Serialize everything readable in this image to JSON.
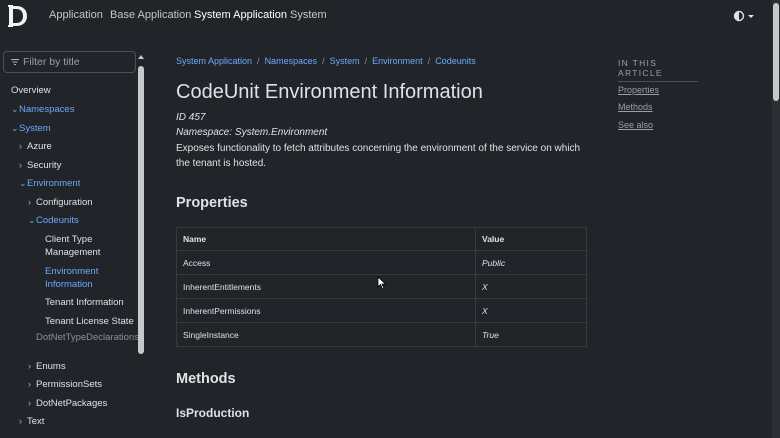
{
  "nav": {
    "items": [
      "Application",
      "Base Application",
      "System Application",
      "System"
    ],
    "active_index": 2,
    "theme_icon": "half-circle-icon"
  },
  "sidebar": {
    "filter_placeholder": "Filter by title",
    "items": [
      {
        "label": "Overview",
        "level": 0,
        "state": "none",
        "style": "normal"
      },
      {
        "label": "Namespaces",
        "level": 0,
        "state": "open",
        "style": "link"
      },
      {
        "label": "System",
        "level": 1,
        "state": "open",
        "style": "link"
      },
      {
        "label": "Azure",
        "level": 2,
        "state": "closed",
        "style": "normal"
      },
      {
        "label": "Security",
        "level": 2,
        "state": "closed",
        "style": "normal"
      },
      {
        "label": "Environment",
        "level": 2,
        "state": "open",
        "style": "link"
      },
      {
        "label": "Configuration",
        "level": 3,
        "state": "closed",
        "style": "normal"
      },
      {
        "label": "Codeunits",
        "level": 3,
        "state": "open",
        "style": "link"
      },
      {
        "label": "Client Type Management",
        "level": 4,
        "state": "none",
        "style": "normal"
      },
      {
        "label": "Environment Information",
        "level": 4,
        "state": "none",
        "style": "link"
      },
      {
        "label": "Tenant Information",
        "level": 4,
        "state": "none",
        "style": "normal"
      },
      {
        "label": "Tenant License State",
        "level": 4,
        "state": "none",
        "style": "normal"
      },
      {
        "label": "DotNetTypeDeclarations",
        "level": 3,
        "state": "none",
        "style": "muted"
      },
      {
        "label": "Enums",
        "level": 3,
        "state": "closed",
        "style": "normal"
      },
      {
        "label": "PermissionSets",
        "level": 3,
        "state": "closed",
        "style": "normal"
      },
      {
        "label": "DotNetPackages",
        "level": 3,
        "state": "closed",
        "style": "normal"
      },
      {
        "label": "Text",
        "level": 2,
        "state": "closed",
        "style": "normal"
      }
    ]
  },
  "breadcrumb": [
    "System Application",
    "Namespaces",
    "System",
    "Environment",
    "Codeunits"
  ],
  "page": {
    "title": "CodeUnit Environment Information",
    "id": "ID 457",
    "namespace": "Namespace: System.Environment",
    "description": "Exposes functionality to fetch attributes concerning the environment of the service on which the tenant is hosted."
  },
  "properties": {
    "heading": "Properties",
    "columns": [
      "Name",
      "Value"
    ],
    "rows": [
      [
        "Access",
        "Public"
      ],
      [
        "InherentEntitlements",
        "X"
      ],
      [
        "InherentPermissions",
        "X"
      ],
      [
        "SingleInstance",
        "True"
      ]
    ]
  },
  "methods": {
    "heading": "Methods",
    "first_method": "IsProduction"
  },
  "toc": {
    "heading": "IN THIS ARTICLE",
    "links": [
      "Properties",
      "Methods",
      "See also"
    ]
  }
}
